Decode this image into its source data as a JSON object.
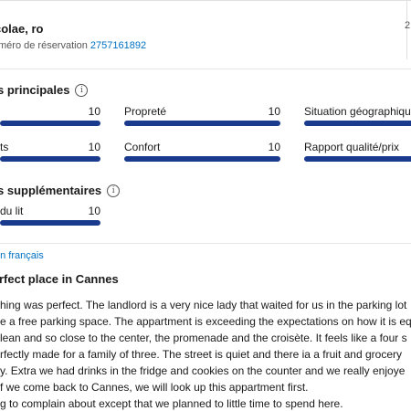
{
  "header": {
    "guest_name": "colae, ro",
    "date_fragment": "2",
    "reservation_label": "méro de réservation",
    "reservation_number": "2757161892"
  },
  "main_scores": {
    "title": "s principales",
    "info_icon": "i",
    "items": [
      {
        "label": "",
        "score": "10",
        "fraction": 1.0
      },
      {
        "label": "Propreté",
        "score": "10",
        "fraction": 1.0
      },
      {
        "label": "Situation géographique",
        "score": "",
        "fraction": 1.0
      },
      {
        "label": "ts",
        "score": "10",
        "fraction": 1.0
      },
      {
        "label": "Confort",
        "score": "10",
        "fraction": 1.0
      },
      {
        "label": "Rapport qualité/prix",
        "score": "",
        "fraction": 1.0
      }
    ]
  },
  "extra_scores": {
    "title": "s supplémentaires",
    "info_icon": "i",
    "items": [
      {
        "label": "du lit",
        "score": "10",
        "fraction": 1.0
      }
    ]
  },
  "language_link": "en français",
  "review": {
    "title": "rfect place in Cannes",
    "lines": [
      "hing was perfect. The landlord is a very nice lady that waited for us in the parking lot",
      "e a free parking space. The appartment is exceeding the expectations on how it is eq",
      "lean and so close to the center, the promenade and the croisète. It feels like a four s",
      "rfectly made for a family of three. The street is quiet and there ia a fruit and grocery",
      "y. Extra we had drinks in the fridge and cookies on the counter and we really enjoye",
      "f we come back to Cannes, we will look up this appartment first.",
      "g to complain about except that we planned to little time to spend here."
    ]
  },
  "colors": {
    "accent_bar": "#1a3a8e",
    "link": "#0071c2"
  }
}
